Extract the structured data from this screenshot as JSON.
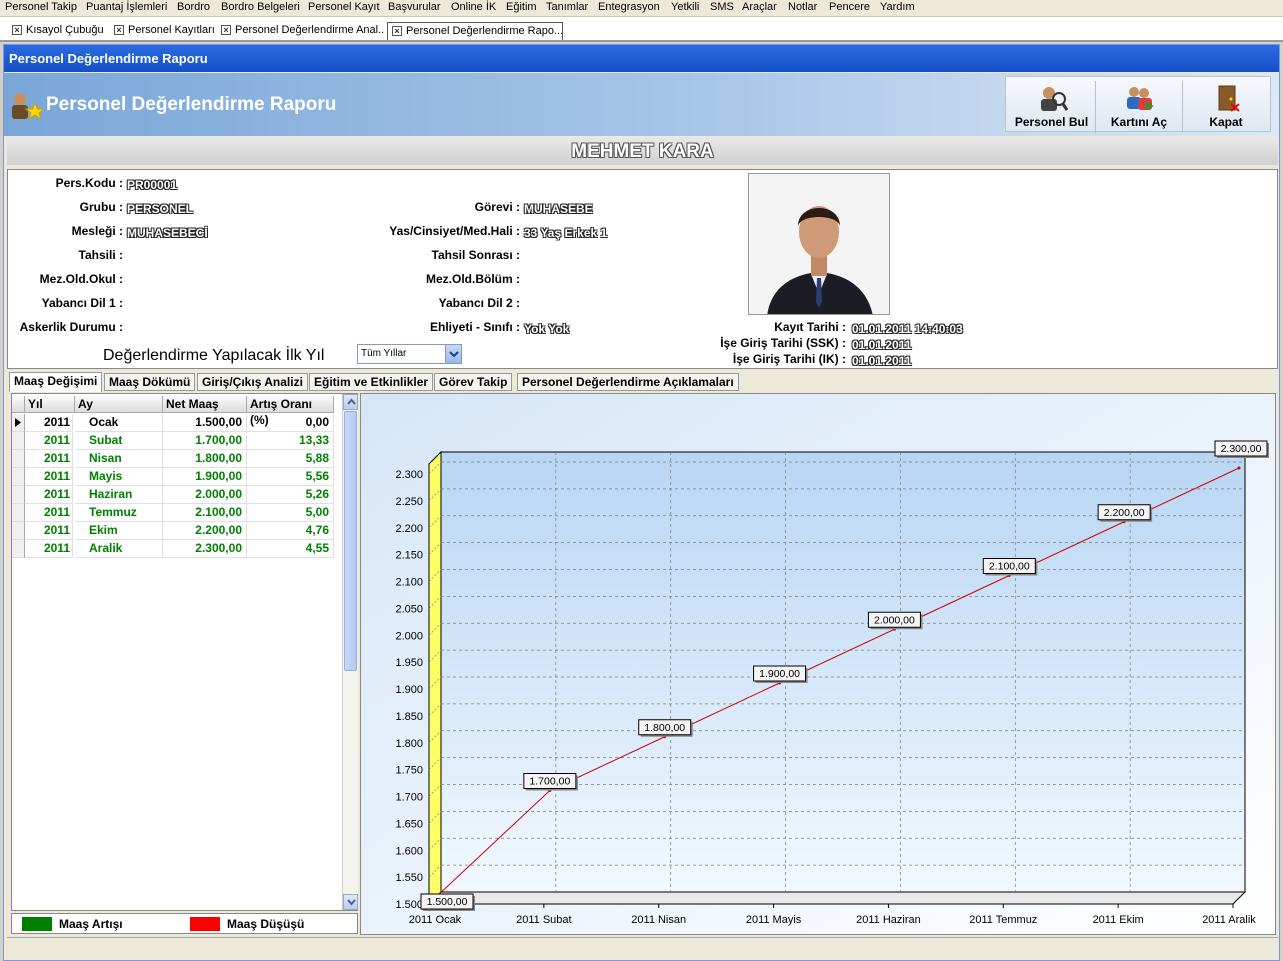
{
  "menu": [
    "Personel Takip",
    "Puantaj İşlemleri",
    "Bordro",
    "Bordro Belgeleri",
    "Personel Kayıt",
    "Başvurular",
    "Online İK",
    "Eğitim",
    "Tanımlar",
    "Entegrasyon",
    "Yetkili",
    "SMS",
    "Araçlar",
    "Notlar",
    "Pencere",
    "Yardım"
  ],
  "doc_tabs": [
    "Kısayol Çubuğu",
    "Personel Kayıtları",
    "Personel Değerlendirme Anal...",
    "Personel Değerlendirme Rapo..."
  ],
  "window_title": "Personel Değerlendirme Raporu",
  "header": {
    "title": "Personel Değerlendirme Raporu",
    "buttons": [
      "Personel Bul",
      "Kartını Aç",
      "Kapat"
    ]
  },
  "employee_name": "MEHMET KARA",
  "fields": {
    "pers_kodu_label": "Pers.Kodu :",
    "pers_kodu": "PR00001",
    "grubu_label": "Grubu :",
    "grubu": "PERSONEL",
    "meslegi_label": "Mesleği :",
    "meslegi": "MUHASEBECİ",
    "tahsili_label": "Tahsili :",
    "mez_okul_label": "Mez.Old.Okul :",
    "yabanci_dil1_label": "Yabancı Dil 1 :",
    "askerlik_label": "Askerlik Durumu :",
    "gorevi_label": "Görevi :",
    "gorevi": "MUHASEBE",
    "yas_label": "Yas/Cinsiyet/Med.Hali :",
    "yas": "33 Yaş Erkek 1",
    "tahsil_sonrasi_label": "Tahsil Sonrası :",
    "mez_bolum_label": "Mez.Old.Bölüm :",
    "yabanci_dil2_label": "Yabancı Dil 2 :",
    "ehliyet_label": "Ehliyeti - Sınıfı :",
    "ehliyet": "Yok  Yok",
    "kayit_tarihi_label": "Kayıt Tarihi :",
    "kayit_tarihi": "01.01.2011 14:40:03",
    "ise_giris_ssk_label": "İşe Giriş Tarihi (SSK) :",
    "ise_giris_ssk": "01.01.2011",
    "ise_giris_ik_label": "İşe Giriş Tarihi (IK) :",
    "ise_giris_ik": "01.01.2011"
  },
  "eval_year_label": "Değerlendirme Yapılacak İlk Yıl",
  "eval_year_value": "Tüm Yıllar",
  "panel_tabs": [
    "Maaş Değişimi",
    "Maaş Dökümü",
    "Giriş/Çıkış Analizi",
    "Eğitim ve Etkinlikler",
    "Görev Takip",
    "Personel Değerlendirme Açıklamaları"
  ],
  "table": {
    "headers": [
      "Yıl",
      "Ay",
      "Net Maaş",
      "Artış Oranı (%)"
    ],
    "rows": [
      [
        "2011",
        "Ocak",
        "1.500,00",
        "0,00"
      ],
      [
        "2011",
        "Subat",
        "1.700,00",
        "13,33"
      ],
      [
        "2011",
        "Nisan",
        "1.800,00",
        "5,88"
      ],
      [
        "2011",
        "Mayis",
        "1.900,00",
        "5,56"
      ],
      [
        "2011",
        "Haziran",
        "2.000,00",
        "5,26"
      ],
      [
        "2011",
        "Temmuz",
        "2.100,00",
        "5,00"
      ],
      [
        "2011",
        "Ekim",
        "2.200,00",
        "4,76"
      ],
      [
        "2011",
        "Aralik",
        "2.300,00",
        "4,55"
      ]
    ]
  },
  "legend": {
    "increase_label": "Maaş Artışı",
    "decrease_label": "Maaş Düşüşü",
    "increase_color": "#008000",
    "decrease_color": "#ff0000"
  },
  "chart_data": {
    "type": "line",
    "categories": [
      "2011 Ocak",
      "2011 Subat",
      "2011 Nisan",
      "2011 Mayis",
      "2011 Haziran",
      "2011 Temmuz",
      "2011 Ekim",
      "2011 Aralik"
    ],
    "values": [
      1500,
      1700,
      1800,
      1900,
      2000,
      2100,
      2200,
      2300
    ],
    "value_labels": [
      "1.500,00",
      "1.700,00",
      "1.800,00",
      "1.900,00",
      "2.000,00",
      "2.100,00",
      "2.200,00",
      "2.300,00"
    ],
    "ylim": [
      1500,
      2300
    ],
    "yticks": [
      "1.500",
      "1.550",
      "1.600",
      "1.650",
      "1.700",
      "1.750",
      "1.800",
      "1.850",
      "1.900",
      "1.950",
      "2.000",
      "2.050",
      "2.100",
      "2.150",
      "2.200",
      "2.250",
      "2.300"
    ],
    "line_color": "#cc0000",
    "grid": true
  }
}
